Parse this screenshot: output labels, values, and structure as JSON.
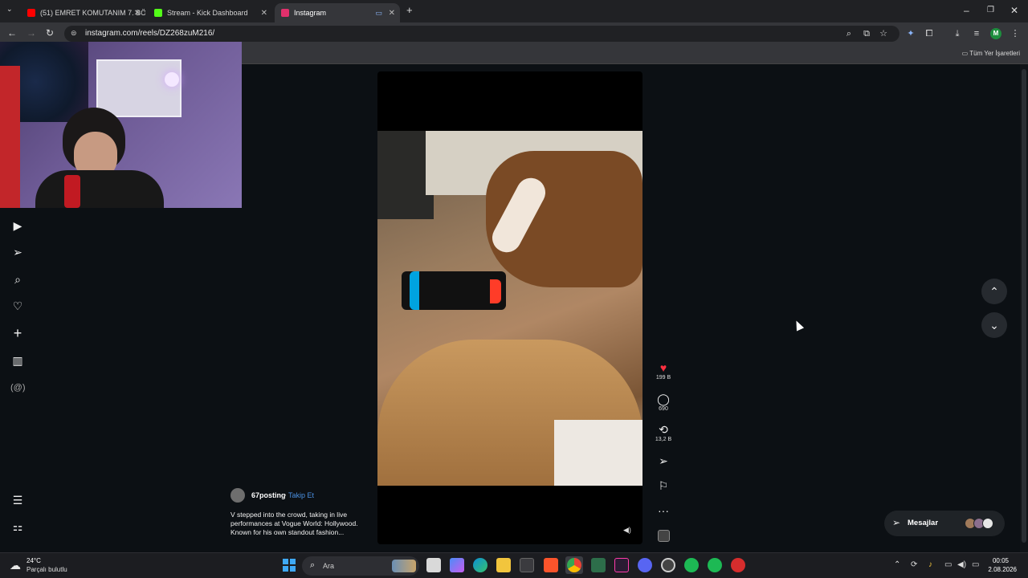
{
  "browser": {
    "tabs": [
      {
        "title": "(51) EMRET KOMUTANIM 7. BÖ",
        "favicon_color": "#ff0000"
      },
      {
        "title": "Stream - Kick Dashboard",
        "favicon_color": "#53fc18"
      },
      {
        "title": "Instagram",
        "favicon_color": "#e1306c"
      }
    ],
    "url": "instagram.com/reels/DZ268zuM216/",
    "bookmarks_all": "Tüm Yer İşaretleri",
    "profile_initial": "M"
  },
  "reel": {
    "username": "67posting",
    "separator": "•",
    "follow_label": "Takip Et",
    "caption": "V stepped into the crowd, taking in live performances at Vogue World: Hollywood. Known for his own standout fashion...",
    "likes": "199 B",
    "comments": "690",
    "reposts": "13,2 B"
  },
  "messages_label": "Mesajlar",
  "taskbar": {
    "temperature": "24°C",
    "condition": "Parçalı bulutlu",
    "search_placeholder": "Ara",
    "time": "00:05",
    "date": "2.08.2026"
  },
  "colors": {
    "like_red": "#ff3040",
    "follow_blue": "#4a90e2",
    "page_bg": "#0c1014"
  }
}
